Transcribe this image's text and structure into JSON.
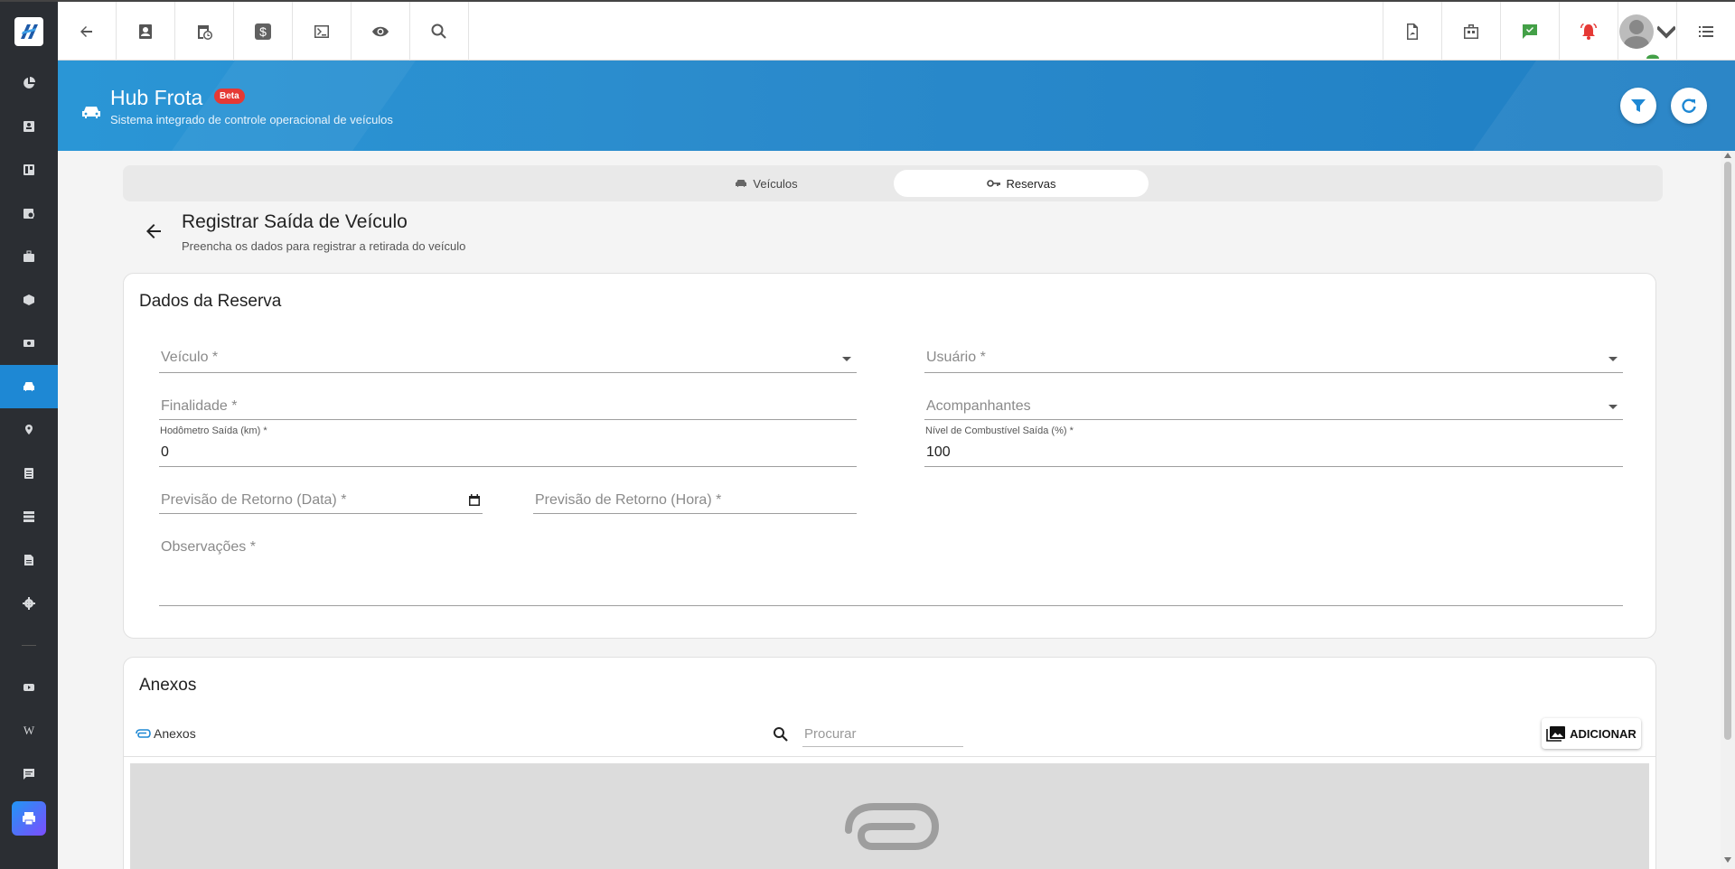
{
  "sidebar": {
    "items": [
      {
        "icon": "pie-chart-icon"
      },
      {
        "icon": "contact-card-icon"
      },
      {
        "icon": "board-icon"
      },
      {
        "icon": "calendar-clock-icon"
      },
      {
        "icon": "briefcase-icon"
      },
      {
        "icon": "cube-icon"
      },
      {
        "icon": "money-icon"
      },
      {
        "icon": "car-icon",
        "active": true
      },
      {
        "icon": "location-icon"
      },
      {
        "icon": "list-icon"
      },
      {
        "icon": "server-icon"
      },
      {
        "icon": "document-icon"
      },
      {
        "icon": "gear-icon"
      }
    ],
    "bottom_items": [
      {
        "icon": "youtube-icon"
      },
      {
        "icon": "wiki-icon",
        "text": "W"
      },
      {
        "icon": "chat-icon"
      },
      {
        "icon": "printer-icon"
      }
    ]
  },
  "topbar": {
    "left_icons": [
      "back-arrow-icon",
      "contact-icon",
      "calendar-clock-icon",
      "dollar-icon",
      "terminal-icon",
      "eye-icon",
      "search-icon"
    ],
    "right_icons": [
      "pdf-icon",
      "briefcase-icon",
      "check-message-icon",
      "alarm-icon",
      "user-avatar",
      "menu-list-icon"
    ],
    "colors": {
      "check": "#43a047",
      "alarm": "#e53935"
    }
  },
  "hub": {
    "title": "Hub Frota",
    "badge": "Beta",
    "subtitle": "Sistema integrado de controle operacional de veículos",
    "colors": {
      "band": "#2a96d6",
      "badge": "#e53935"
    }
  },
  "tabs": [
    {
      "label": "Veículos",
      "icon": "car-icon",
      "active": false
    },
    {
      "label": "Reservas",
      "icon": "key-icon",
      "active": true
    }
  ],
  "page": {
    "title": "Registrar Saída de Veículo",
    "subtitle": "Preencha os dados para registrar a retirada do veículo"
  },
  "form": {
    "section_title": "Dados da Reserva",
    "veiculo": {
      "placeholder": "Veículo *"
    },
    "usuario": {
      "placeholder": "Usuário *"
    },
    "finalidade": {
      "placeholder": "Finalidade *"
    },
    "acompanhantes": {
      "placeholder": "Acompanhantes"
    },
    "hodometro": {
      "label": "Hodômetro Saída (km) *",
      "value": "0"
    },
    "combustivel": {
      "label": "Nível de Combustível Saída (%) *",
      "value": "100"
    },
    "retorno_data": {
      "placeholder": "Previsão de Retorno (Data) *"
    },
    "retorno_hora": {
      "placeholder": "Previsão de Retorno (Hora) *"
    },
    "observacoes": {
      "placeholder": "Observações *"
    }
  },
  "attachments": {
    "section_title": "Anexos",
    "tab_label": "Anexos",
    "search_placeholder": "Procurar",
    "add_label": "ADICIONAR"
  }
}
